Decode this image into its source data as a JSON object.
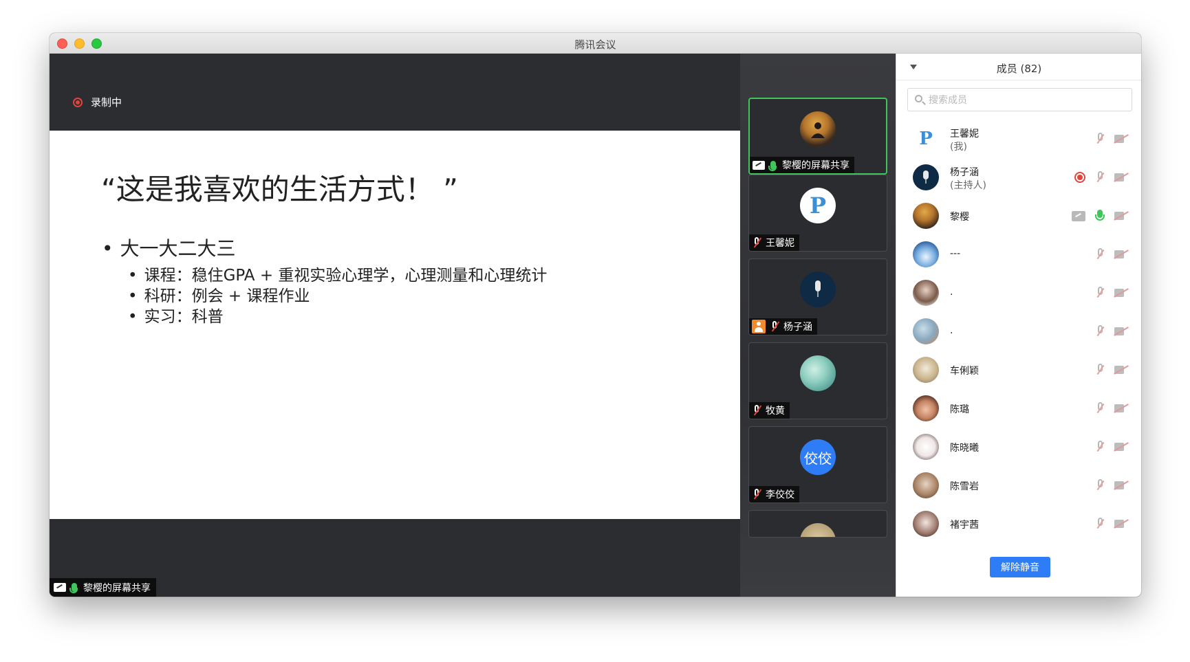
{
  "window": {
    "title": "腾讯会议"
  },
  "recording": {
    "label": "录制中"
  },
  "slide": {
    "title": "“这是我喜欢的生活方式！ ”",
    "bullet": "大一大二大三",
    "subs": [
      "课程：稳住GPA + 重视实验心理学，心理测量和心理统计",
      "科研：例会 + 课程作业",
      "实习：科普"
    ]
  },
  "share_label": "黎樱的屏幕共享",
  "tiles": [
    {
      "label": "黎樱的屏幕共享",
      "avatar": ""
    },
    {
      "label": "王馨妮",
      "avatar": "P"
    },
    {
      "label": "杨子涵",
      "avatar": ""
    },
    {
      "label": "牧黄",
      "avatar": ""
    },
    {
      "label": "李佼佼",
      "avatar": "佼佼"
    }
  ],
  "panel": {
    "title": "成员 (82)",
    "search_placeholder": "搜索成员",
    "unmute_label": "解除静音"
  },
  "members": [
    {
      "name": "王馨妮",
      "role": "(我)",
      "avatar": "P"
    },
    {
      "name": "杨子涵",
      "role": "(主持人)",
      "avatar": ""
    },
    {
      "name": "黎樱",
      "role": "",
      "avatar": ""
    },
    {
      "name": "---",
      "role": "",
      "avatar": ""
    },
    {
      "name": ".",
      "role": "",
      "avatar": ""
    },
    {
      "name": ".",
      "role": "",
      "avatar": ""
    },
    {
      "name": "车俐颖",
      "role": "",
      "avatar": ""
    },
    {
      "name": "陈璐",
      "role": "",
      "avatar": ""
    },
    {
      "name": "陈晓曦",
      "role": "",
      "avatar": ""
    },
    {
      "name": "陈雪岩",
      "role": "",
      "avatar": ""
    },
    {
      "name": "褚宇茜",
      "role": "",
      "avatar": ""
    }
  ],
  "colors": {
    "accent": "#2f7df6",
    "active_border": "#3fc55b",
    "recording": "#e0443c"
  }
}
